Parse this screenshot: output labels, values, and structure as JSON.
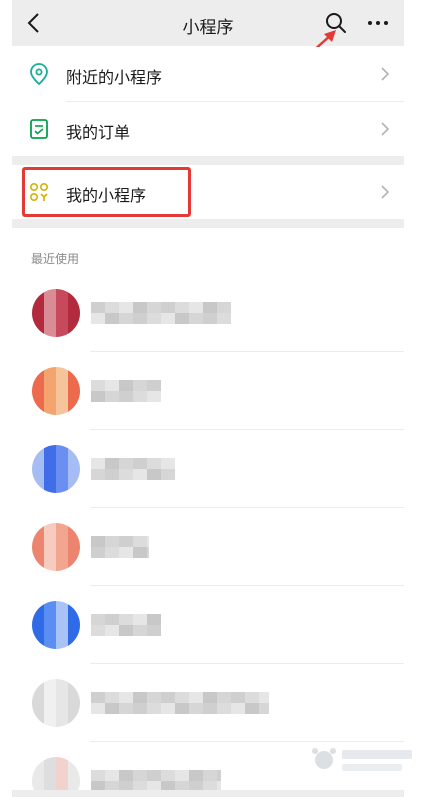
{
  "header": {
    "title": "小程序",
    "back_icon": "chevron-left-icon",
    "search_icon": "search-icon",
    "more_icon": "more-horizontal-icon"
  },
  "menu": [
    {
      "label": "附近的小程序",
      "icon": "location-pin-icon",
      "icon_color": "#1aad9a"
    },
    {
      "label": "我的订单",
      "icon": "order-check-icon",
      "icon_color": "#07a04c"
    },
    {
      "label": "我的小程序",
      "icon": "mini-program-grid-icon",
      "icon_color": "#d4b106"
    }
  ],
  "recent": {
    "section_title": "最近使用",
    "item_count_visible": 7,
    "items": [
      {
        "avatar_colors": [
          "#b22a3e",
          "#c64a5b",
          "#d98b96"
        ]
      },
      {
        "avatar_colors": [
          "#f4a56f",
          "#ec6a4e",
          "#f5c49a"
        ]
      },
      {
        "avatar_colors": [
          "#6b8ff0",
          "#3f6ee8",
          "#a6bdf4"
        ]
      },
      {
        "avatar_colors": [
          "#ec8570",
          "#f2a690",
          "#f7cbbd"
        ]
      },
      {
        "avatar_colors": [
          "#5a8ef2",
          "#2f6be6",
          "#a9c3f7"
        ]
      },
      {
        "avatar_colors": [
          "#e6e6e6",
          "#f0f0f0",
          "#d9d9d9"
        ]
      },
      {
        "avatar_colors": [
          "#e9e9e9",
          "#f2d2cc",
          "#dedede"
        ]
      }
    ]
  },
  "colors": {
    "background_gray": "#ededed",
    "highlight_red": "#e53935",
    "annotation_arrow": "#e53935"
  }
}
